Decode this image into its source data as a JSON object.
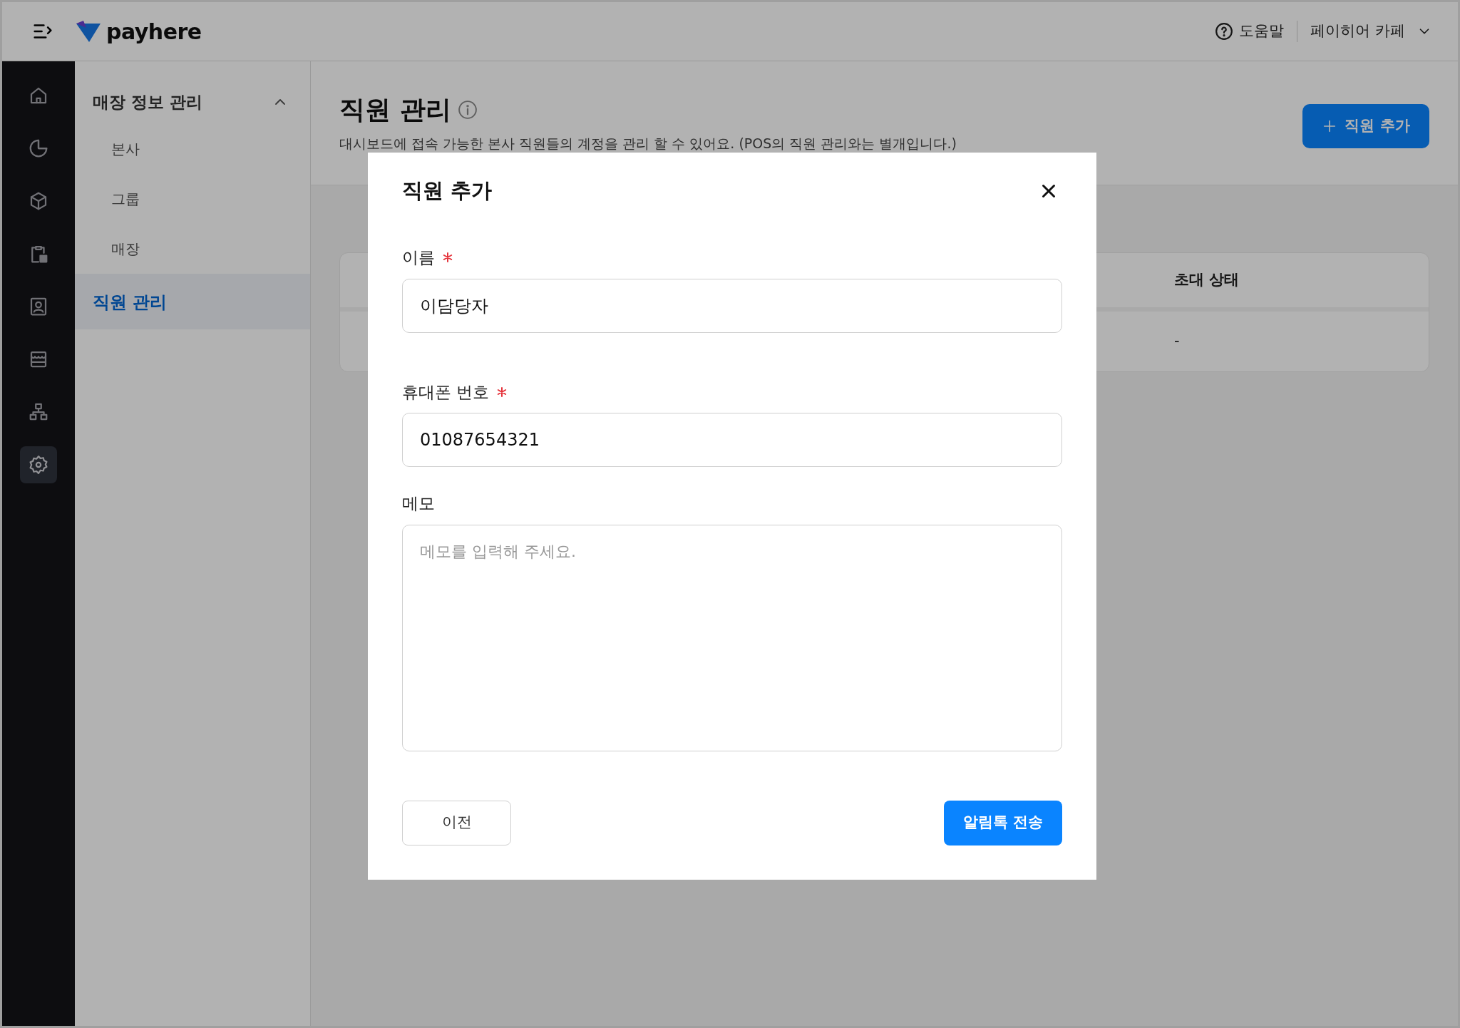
{
  "top_bar": {
    "logo_text": "payhere",
    "help": "도움말",
    "store_selector": "페이히어 카페"
  },
  "icon_rail": [
    {
      "kind": "home",
      "selected": false
    },
    {
      "kind": "chart",
      "selected": false
    },
    {
      "kind": "box",
      "selected": false
    },
    {
      "kind": "clipboard",
      "selected": false
    },
    {
      "kind": "contact",
      "selected": false
    },
    {
      "kind": "store",
      "selected": false
    },
    {
      "kind": "org",
      "selected": false
    },
    {
      "kind": "settings",
      "selected": true
    }
  ],
  "sidebar": {
    "group": {
      "label": "매장 정보 관리",
      "expanded": true,
      "children": [
        {
          "label": "본사",
          "selected": false
        },
        {
          "label": "그룹",
          "selected": false
        },
        {
          "label": "매장",
          "selected": false
        }
      ]
    },
    "items": [
      {
        "label": "직원 관리",
        "selected": true
      }
    ]
  },
  "page": {
    "title": "직원 관리",
    "subtitle": "대시보드에 접속 가능한 본사 직원들의 계정을 관리 할 수 있어요. (POS의 직원 관리와는 별개입니다.)",
    "add_button": "직원 추가"
  },
  "table": {
    "columns": [
      "초대 상태"
    ],
    "rows": [
      [
        "-"
      ]
    ]
  },
  "dialog": {
    "title": "직원 추가",
    "fields": [
      {
        "kind": "input",
        "label": "이름",
        "required": true,
        "value": "이담당자"
      },
      {
        "kind": "input",
        "label": "휴대폰 번호",
        "required": true,
        "value": "01087654321"
      },
      {
        "kind": "textarea",
        "label": "메모",
        "required": false,
        "placeholder": "메모를 입력해 주세요."
      }
    ],
    "buttons": [
      {
        "kind": "secondary",
        "label": "이전"
      },
      {
        "kind": "primary",
        "label": "알림톡 전송"
      }
    ]
  }
}
